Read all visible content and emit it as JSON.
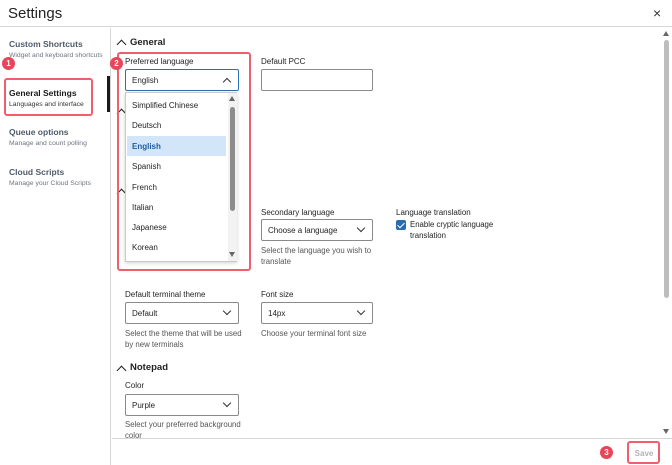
{
  "window": {
    "title": "Settings",
    "close_glyph": "×"
  },
  "sidebar": {
    "items": [
      {
        "title": "Custom Shortcuts",
        "subtitle": "Widget and keyboard shortcuts",
        "active": false
      },
      {
        "title": "General Settings",
        "subtitle": "Languages and interface",
        "active": true
      },
      {
        "title": "Queue options",
        "subtitle": "Manage and count polling",
        "active": false
      },
      {
        "title": "Cloud Scripts",
        "subtitle": "Manage your Cloud Scripts",
        "active": false
      }
    ]
  },
  "annotations": {
    "badge_1": "1",
    "badge_2": "2",
    "badge_3": "3",
    "highlight_color": "#f0606c",
    "badge_color": "#e9445a"
  },
  "general": {
    "header": "General",
    "preferred_language": {
      "label": "Preferred language",
      "value": "English",
      "options": [
        "Simplified Chinese",
        "Deutsch",
        "English",
        "Spanish",
        "French",
        "Italian",
        "Japanese",
        "Korean"
      ],
      "selected": "English"
    },
    "default_pcc": {
      "label": "Default PCC",
      "value": ""
    },
    "secondary_language": {
      "label": "Secondary language",
      "value": "Choose a language",
      "help": "Select the language you wish to translate"
    },
    "language_translation": {
      "label": "Language translation",
      "checkbox_label": "Enable cryptic language translation",
      "checked": true
    },
    "default_terminal_theme": {
      "label": "Default terminal theme",
      "value": "Default",
      "help": "Select the theme that will be used by new terminals"
    },
    "font_size": {
      "label": "Font size",
      "value": "14px",
      "help": "Choose your terminal font size"
    }
  },
  "notepad": {
    "header": "Notepad",
    "color": {
      "label": "Color",
      "value": "Purple",
      "help": "Select your preferred background color"
    }
  },
  "footer": {
    "save_label": "Save"
  },
  "colors": {
    "accent": "#2b6cb0",
    "selected_option_bg": "#d3e5f8",
    "border": "#d6d6d6"
  }
}
